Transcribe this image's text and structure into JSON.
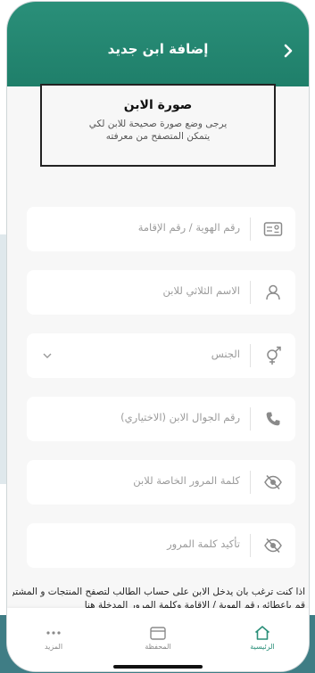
{
  "header": {
    "title": "إضافة ابن جديد",
    "back_icon": "chevron-right-icon"
  },
  "photo": {
    "title": "صورة الابن",
    "description": "يرجى وضع صورة صحيحة للابن لكي يتمكن المتصفح من معرفته"
  },
  "fields": {
    "id_number": {
      "placeholder": "رقم الهوية / رقم الإقامة",
      "icon": "id-card-icon"
    },
    "full_name": {
      "placeholder": "الاسم الثلاثي للابن",
      "icon": "person-icon"
    },
    "gender": {
      "placeholder": "الجنس",
      "icon": "gender-icon"
    },
    "mobile": {
      "placeholder": "رقم الجوال الابن (الاختياري)",
      "icon": "phone-icon"
    },
    "password": {
      "placeholder": "كلمة المرور الخاصة للابن",
      "icon": "eye-off-icon"
    },
    "confirm_password": {
      "placeholder": "تأكيد كلمة المرور",
      "icon": "eye-off-icon"
    }
  },
  "note": {
    "line1": "اذا كنت ترغب بان يدخل الابن على حساب الطالب لتصفح المنتجات و المشتريات",
    "line2": "قم باعطائه رقم الهوية / الاقامة وكلمة المرور المدخلة هنا"
  },
  "tabbar": {
    "home": "الرئيسية",
    "wallet": "المحفظة",
    "more": "المزيد"
  },
  "colors": {
    "accent": "#2a8f79",
    "background": "#f7f7f7"
  }
}
